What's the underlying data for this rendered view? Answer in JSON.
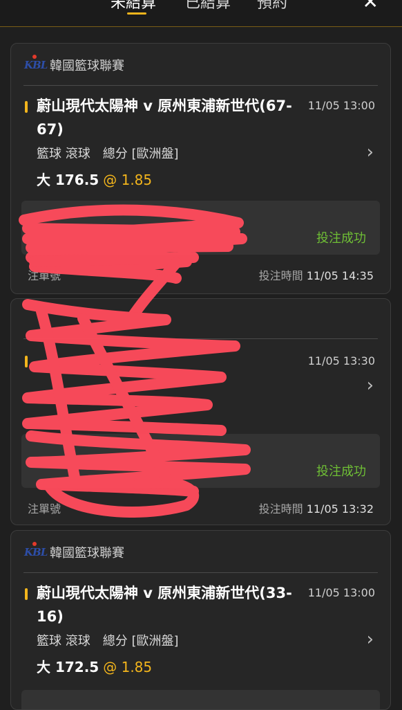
{
  "tabs": [
    "未結算",
    "已結算",
    "預約"
  ],
  "close_symbol": "✕",
  "chevron": "›",
  "cards": [
    {
      "league": "韓國籃球聯賽",
      "logo_text": "KBL",
      "match": "蔚山現代太陽神 v 原州東浦新世代(67-67)",
      "time": "11/05 13:00",
      "market": "籃球 滾球　總分 [歐洲盤]",
      "selection": "大 176.5",
      "odds": "@ 1.85",
      "status": "投注成功",
      "order_label": "注單號",
      "bet_time_label": "投注時間",
      "bet_time": "11/05 14:35"
    },
    {
      "league": "",
      "logo_text": "",
      "match": "",
      "time": "11/05 13:30",
      "market": "",
      "selection": "",
      "odds": "",
      "status": "投注成功",
      "order_label": "注單號",
      "bet_time_label": "投注時間",
      "bet_time": "11/05 13:32"
    },
    {
      "league": "韓國籃球聯賽",
      "logo_text": "KBL",
      "match": "蔚山現代太陽神 v 原州東浦新世代(33-16)",
      "time": "11/05 13:00",
      "market": "籃球 滾球　總分 [歐洲盤]",
      "selection": "大 172.5",
      "odds": "@ 1.85",
      "status": "",
      "order_label": "",
      "bet_time_label": "",
      "bet_time": ""
    }
  ],
  "colors": {
    "background": "#1f1f1f",
    "card": "#262626",
    "accent": "#f3b51c",
    "success": "#6fbf35",
    "redaction": "#ff4b5c"
  }
}
